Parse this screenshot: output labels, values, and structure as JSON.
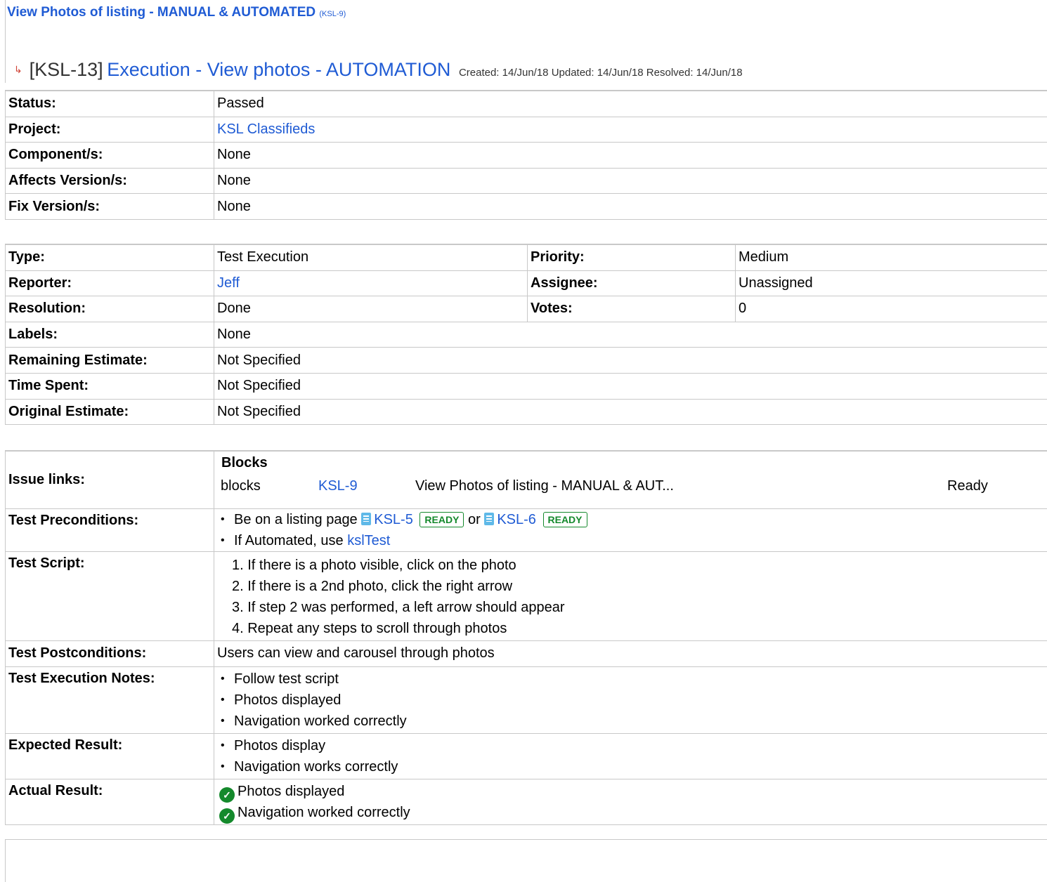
{
  "parent": {
    "summary": "View Photos of listing - MANUAL & AUTOMATED",
    "key": "(KSL-9)"
  },
  "issue": {
    "key": "[KSL-13]",
    "summary": "Execution - View photos - AUTOMATION",
    "dates": "Created: 14/Jun/18  Updated: 14/Jun/18  Resolved: 14/Jun/18"
  },
  "fields1": [
    {
      "label": "Status:",
      "value": "Passed",
      "link": false
    },
    {
      "label": "Project:",
      "value": "KSL Classifieds",
      "link": true
    },
    {
      "label": "Component/s:",
      "value": "None",
      "link": false
    },
    {
      "label": "Affects Version/s:",
      "value": "None",
      "link": false
    },
    {
      "label": "Fix Version/s:",
      "value": "None",
      "link": false
    }
  ],
  "fields2": {
    "type_label": "Type:",
    "type": "Test Execution",
    "priority_label": "Priority:",
    "priority": "Medium",
    "reporter_label": "Reporter:",
    "reporter": "Jeff",
    "assignee_label": "Assignee:",
    "assignee": "Unassigned",
    "resolution_label": "Resolution:",
    "resolution": "Done",
    "votes_label": "Votes:",
    "votes": "0",
    "labels_label": "Labels:",
    "labels": "None",
    "remaining_label": "Remaining Estimate:",
    "remaining": "Not Specified",
    "spent_label": "Time Spent:",
    "spent": "Not Specified",
    "original_label": "Original Estimate:",
    "original": "Not Specified"
  },
  "issue_links": {
    "label": "Issue links:",
    "heading": "Blocks",
    "row": {
      "relation": "blocks",
      "key": "KSL-9",
      "summary": "View Photos of listing - MANUAL & AUT...",
      "status": "Ready"
    }
  },
  "preconditions": {
    "label": "Test Preconditions:",
    "line1_text": "Be on a listing page",
    "ref1_key": "KSL-5",
    "ref1_status": "READY",
    "or": "or",
    "ref2_key": "KSL-6",
    "ref2_status": "READY",
    "line2_text": "If Automated, use",
    "line2_link": "kslTest"
  },
  "script": {
    "label": "Test Script:",
    "steps": [
      "1. If there is a photo visible, click on the photo",
      "2. If there is a 2nd photo, click the right arrow",
      "3. If step 2 was performed, a left arrow should appear",
      "4. Repeat any steps to scroll through photos"
    ]
  },
  "postconditions": {
    "label": "Test Postconditions:",
    "value": "Users can view and carousel through photos"
  },
  "notes": {
    "label": "Test Execution Notes:",
    "items": [
      "Follow test script",
      "Photos displayed",
      "Navigation worked correctly"
    ]
  },
  "expected": {
    "label": "Expected Result:",
    "items": [
      "Photos display",
      "Navigation works correctly"
    ]
  },
  "actual": {
    "label": "Actual Result:",
    "items": [
      "Photos displayed",
      "Navigation worked correctly"
    ]
  },
  "colors": {
    "link": "#1f5bd4",
    "border": "#c8c8c8",
    "ready": "#14892c"
  }
}
